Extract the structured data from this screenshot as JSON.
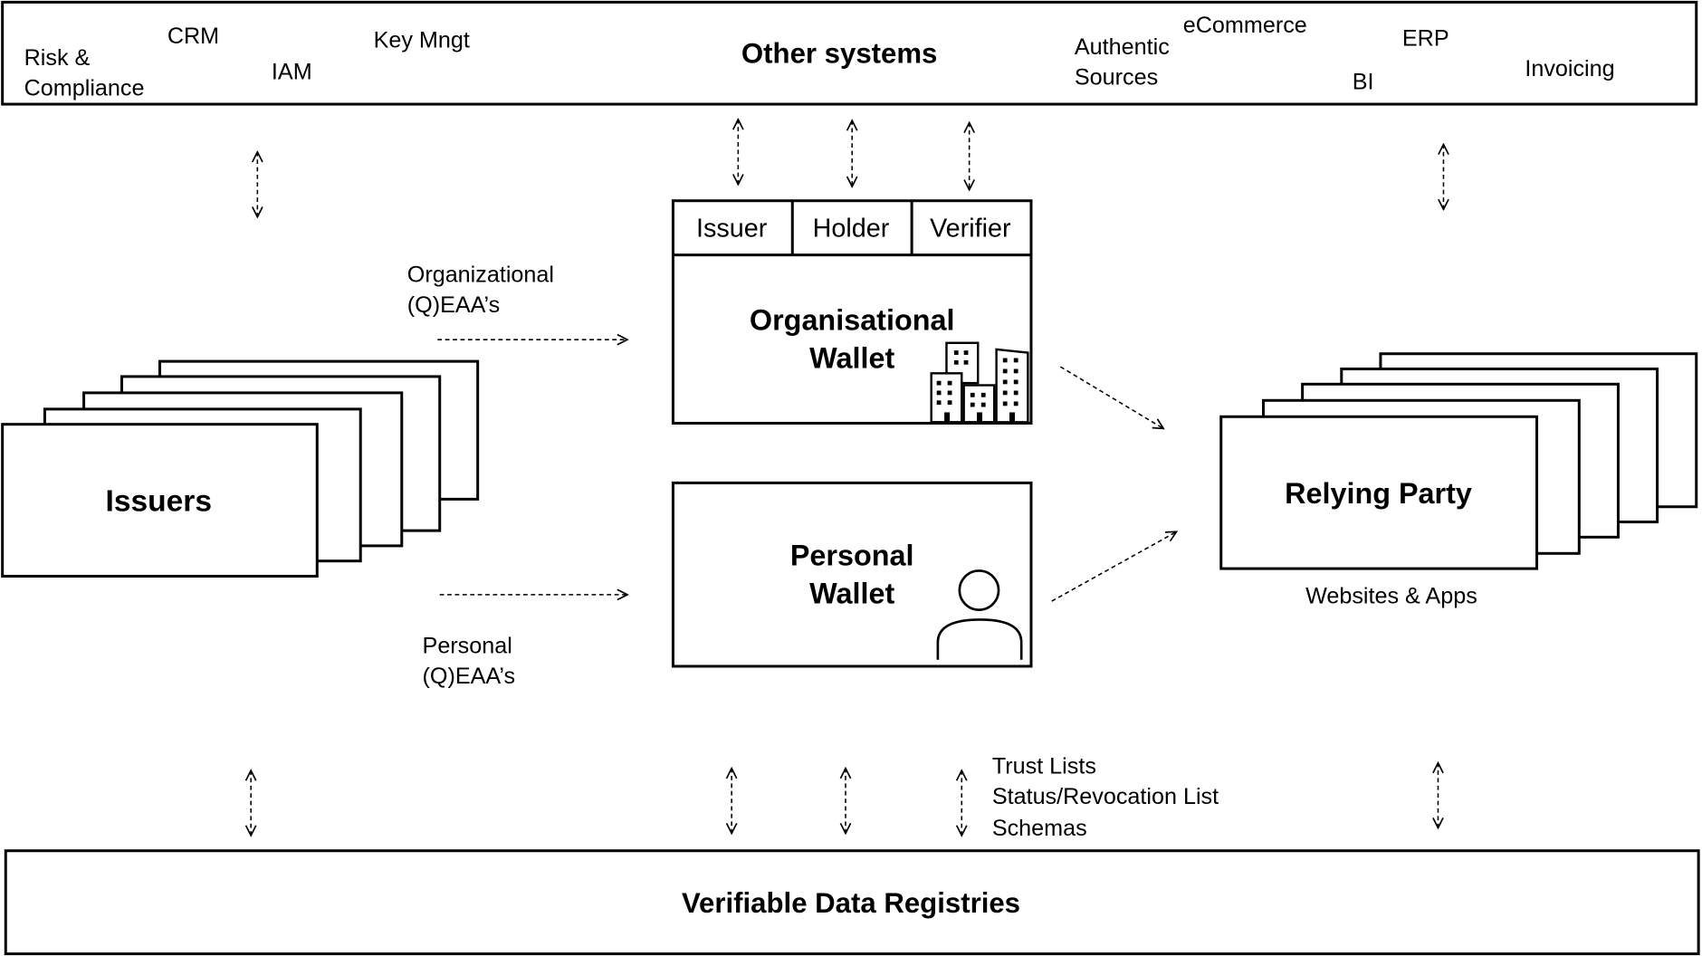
{
  "other_systems": {
    "title": "Other systems",
    "items": [
      "Risk &",
      "Compliance",
      "CRM",
      "IAM",
      "Key Mngt",
      "Authentic",
      "Sources",
      "eCommerce",
      "ERP",
      "BI",
      "Invoicing"
    ]
  },
  "org_wallet": {
    "roles": [
      "Issuer",
      "Holder",
      "Verifier"
    ],
    "title_line1": "Organisational",
    "title_line2": "Wallet",
    "icon": "buildings-icon"
  },
  "personal_wallet": {
    "title_line1": "Personal",
    "title_line2": "Wallet",
    "icon": "person-icon"
  },
  "issuers": {
    "title": "Issuers"
  },
  "relying_party": {
    "title": "Relying Party",
    "caption": "Websites & Apps"
  },
  "flows": {
    "org_label_1": "Organizational",
    "org_label_2": "(Q)EAA’s",
    "personal_label_1": "Personal",
    "personal_label_2": "(Q)EAA’s"
  },
  "registry": {
    "title": "Verifiable Data Registries",
    "items": [
      "Trust Lists",
      "Status/Revocation List",
      "Schemas"
    ]
  }
}
